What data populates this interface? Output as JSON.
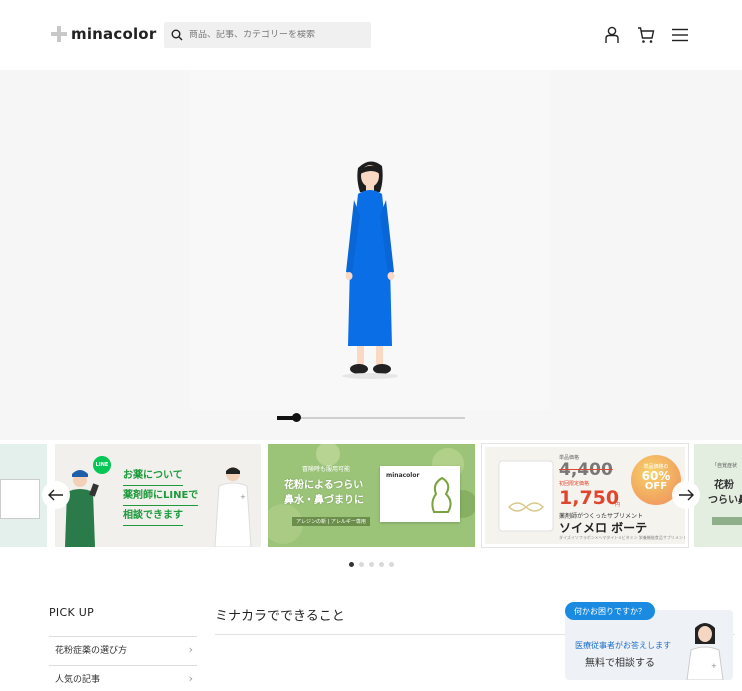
{
  "header": {
    "logo_text": "minacolor",
    "search_placeholder": "商品、記事、カテゴリーを検索",
    "icons": [
      "user-icon",
      "cart-icon",
      "menu-icon"
    ]
  },
  "hero": {
    "slider_progress": 0.1
  },
  "banners": {
    "slides": [
      {
        "name": "line-consult",
        "line_badge": "LINE",
        "lines": [
          "お薬について",
          "薬剤師にLINEで",
          "相談できます"
        ]
      },
      {
        "name": "hay-fever",
        "small": "冒険時も服用可能",
        "lines": [
          "花粉によるつらい",
          "鼻水・鼻づまりに"
        ],
        "tag": "アレジンの新 | アレルギー専用",
        "box_brand": "minacolor"
      },
      {
        "name": "soymelo",
        "price_label_top": "単品価格",
        "old_price": "4,400",
        "new_label": "初回限定価格",
        "new_price": "1,750",
        "yen": "円",
        "discount_top": "単品価格の",
        "discount_value": "60%",
        "discount_bottom": "OFF",
        "tagline": "薬剤師がつくったサプリメント",
        "product": "ソイメロ ボーテ",
        "fine_print": "ダイズイソフラボン×ヘマタイト×ビタミン 栄養機能食品サプリメント"
      },
      {
        "name": "partial",
        "lines": [
          "「自覚症状",
          "花粉",
          "つらい鼻"
        ]
      }
    ],
    "active_dot": 0,
    "dot_count": 5
  },
  "pickup": {
    "title": "PICK UP",
    "items": [
      "花粉症薬の選び方",
      "人気の記事"
    ]
  },
  "section": {
    "title": "ミナカラでできること"
  },
  "help": {
    "bubble": "何かお困りですか？",
    "line1": "医療従事者がお答えします",
    "line2": "無料で相談する"
  },
  "colors": {
    "accent_blue": "#1a8be0",
    "line_green": "#06c755",
    "figure_blue": "#0a6ee6",
    "discount_red": "#e0452e"
  }
}
